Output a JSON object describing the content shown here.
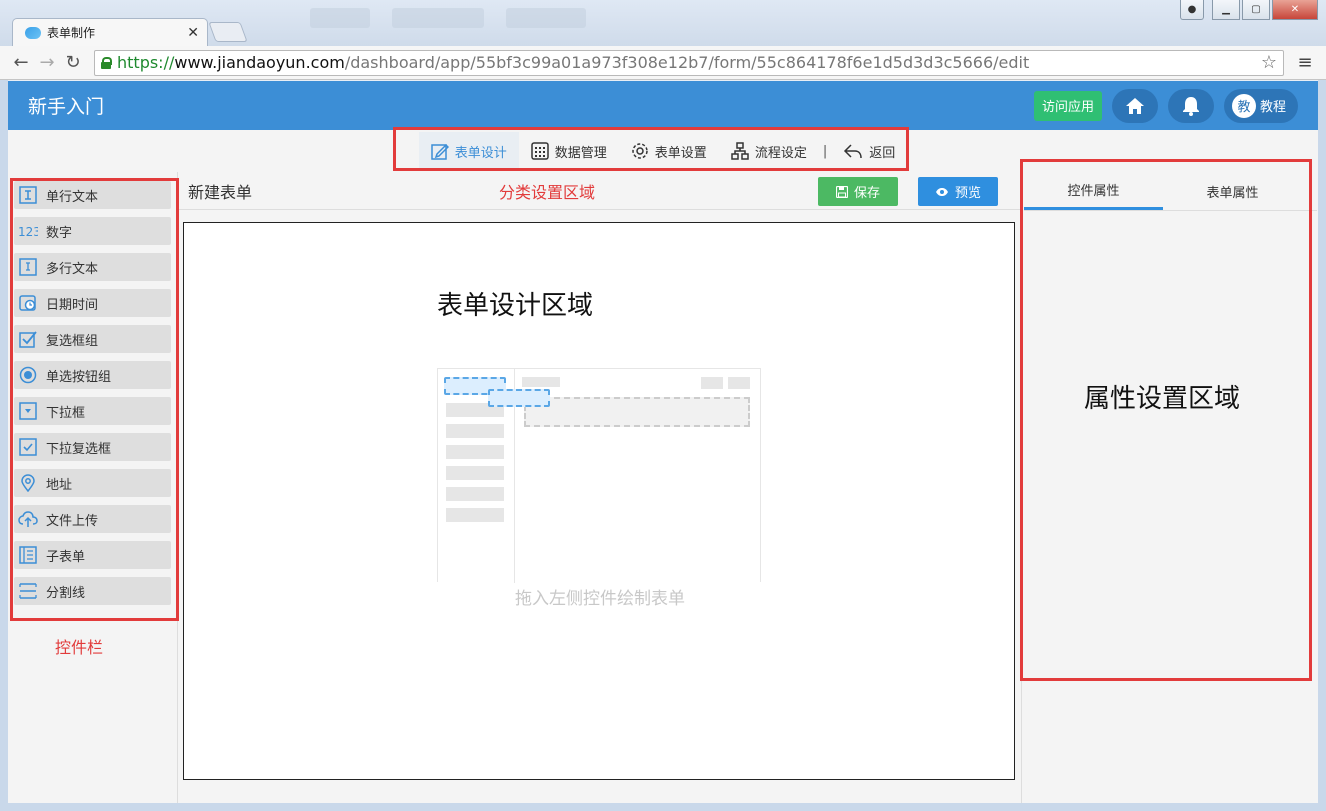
{
  "browser": {
    "tab_title": "表单制作",
    "url_scheme": "https://",
    "url_host": "www.jiandaoyun.com",
    "url_path": "/dashboard/app/55bf3c99a01a973f308e12b7/form/55c864178f6e1d5d3d3c5666/edit"
  },
  "header": {
    "app_title": "新手入门",
    "visit_label": "访问应用",
    "avatar_char": "教",
    "tutorial_label": "教程"
  },
  "tabbar": {
    "items": [
      {
        "label": "表单设计",
        "icon": "edit-icon"
      },
      {
        "label": "数据管理",
        "icon": "grid-icon"
      },
      {
        "label": "表单设置",
        "icon": "gear-icon"
      },
      {
        "label": "流程设定",
        "icon": "flow-icon"
      },
      {
        "label": "返回",
        "icon": "return-icon"
      }
    ],
    "separator": "|"
  },
  "controls": [
    {
      "label": "单行文本",
      "icon": "text-line-icon"
    },
    {
      "label": "数字",
      "icon": "number-icon"
    },
    {
      "label": "多行文本",
      "icon": "textarea-icon"
    },
    {
      "label": "日期时间",
      "icon": "clock-icon"
    },
    {
      "label": "复选框组",
      "icon": "checkbox-group-icon"
    },
    {
      "label": "单选按钮组",
      "icon": "radio-icon"
    },
    {
      "label": "下拉框",
      "icon": "dropdown-icon"
    },
    {
      "label": "下拉复选框",
      "icon": "dropdown-checkbox-icon"
    },
    {
      "label": "地址",
      "icon": "location-icon"
    },
    {
      "label": "文件上传",
      "icon": "upload-icon"
    },
    {
      "label": "子表单",
      "icon": "subform-icon"
    },
    {
      "label": "分割线",
      "icon": "divider-icon"
    }
  ],
  "form": {
    "title": "新建表单",
    "save_label": "保存",
    "preview_label": "预览",
    "drop_hint": "拖入左侧控件绘制表单"
  },
  "right_panel": {
    "tabs": [
      "控件属性",
      "表单属性"
    ]
  },
  "annotations": {
    "tabbar_area": "分类设置区域",
    "controls_bar": "控件栏",
    "form_design_area": "表单设计区域",
    "property_area": "属性设置区域"
  },
  "colors": {
    "header_bg": "#3c8ed6",
    "accent": "#2f8fdf",
    "save_green": "#4cb963",
    "visit_green": "#2fbf73",
    "annotation_red": "#e23b3b"
  }
}
